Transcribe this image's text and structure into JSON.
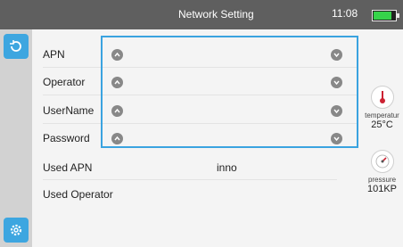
{
  "header": {
    "title": "Network Setting",
    "time": "11:08",
    "battery_level": 0.75
  },
  "fields": [
    {
      "label": "APN"
    },
    {
      "label": "Operator"
    },
    {
      "label": "UserName"
    },
    {
      "label": "Password"
    }
  ],
  "info": [
    {
      "label": "Used APN",
      "value": "inno"
    },
    {
      "label": "Used Operator",
      "value": ""
    }
  ],
  "sensors": {
    "temperature_label": "temperatur",
    "temperature_value": "25°C",
    "pressure_label": "pressure",
    "pressure_value": "101KP"
  },
  "colors": {
    "accent": "#3aa3e0",
    "topbar": "#5f5f5f",
    "battery": "#36d34a"
  }
}
